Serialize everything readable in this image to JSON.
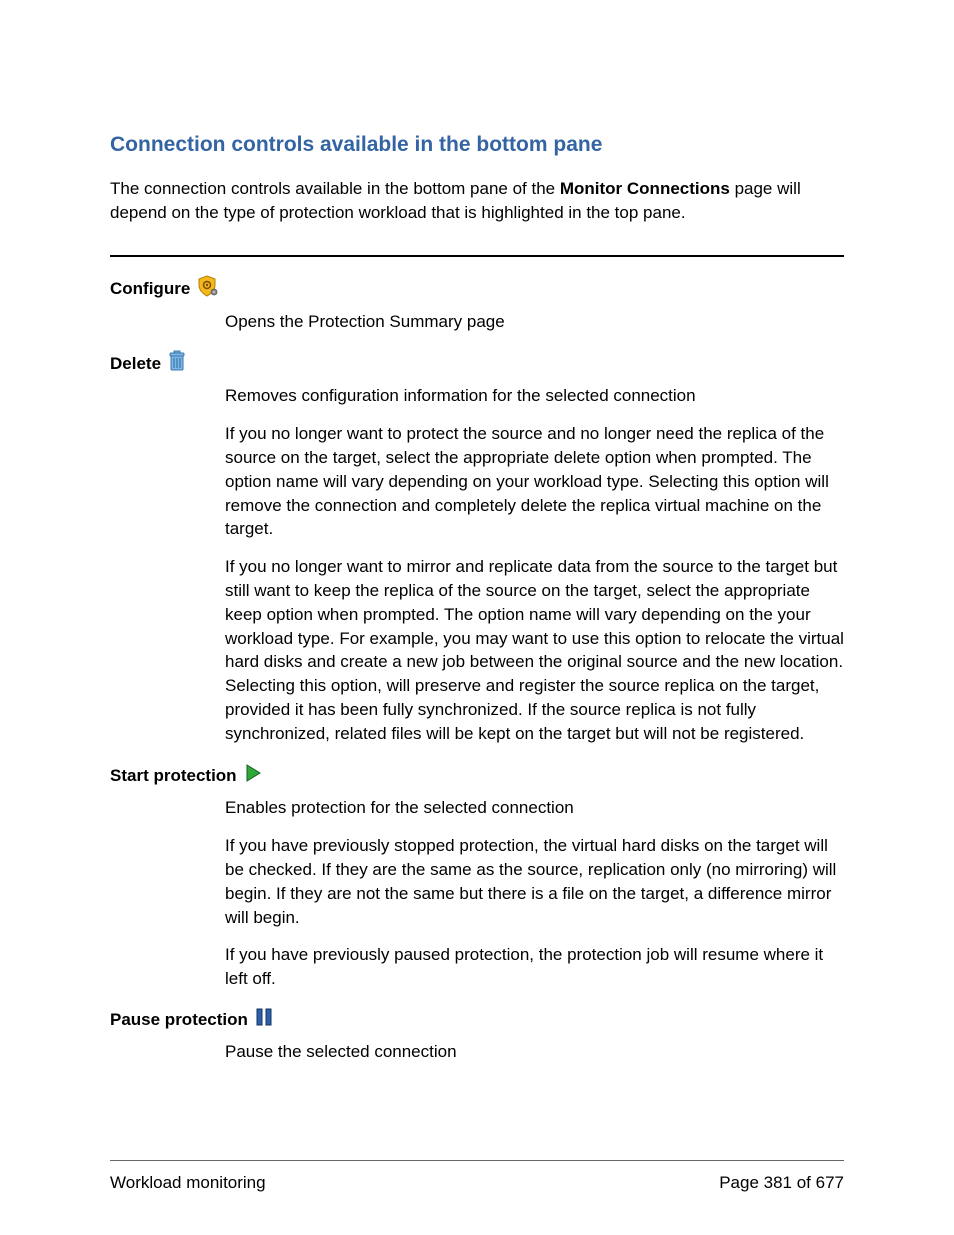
{
  "title": "Connection controls available in the bottom pane",
  "intro_pre": "The connection controls available in the bottom pane of the ",
  "intro_bold": "Monitor Connections",
  "intro_post": " page will depend on the type of protection workload that is highlighted in the top pane.",
  "items": {
    "configure": {
      "label": "Configure",
      "p1": "Opens the Protection Summary page"
    },
    "delete": {
      "label": "Delete",
      "p1": "Removes configuration information for the selected connection",
      "p2": "If you no longer want to protect the source and no longer need the replica of the source on the target, select the appropriate delete option when prompted. The option name will vary depending on your workload type. Selecting this option will remove the connection and completely delete the replica virtual machine on the target.",
      "p3": "If you no longer want to mirror and replicate data from the source to the target but still want to keep the replica of the source on the target, select the appropriate keep option when prompted. The option name will vary depending on the your workload type. For example, you may want to use this option to relocate the virtual hard disks and create a new job between the original source and the new location. Selecting this option, will preserve and register the source replica on the target, provided it has been fully synchronized. If the source replica is not fully synchronized, related files will be kept on the target but will not be registered."
    },
    "start": {
      "label": "Start protection",
      "p1": "Enables protection for the selected connection",
      "p2": "If you have previously stopped protection, the virtual hard disks on the target will be checked. If they are the same as the source, replication only (no mirroring) will begin. If they are not the same but there is a file on the target, a difference mirror will begin.",
      "p3": "If you have previously paused protection, the protection job will resume where it left off."
    },
    "pause": {
      "label": "Pause protection",
      "p1": "Pause the selected connection"
    }
  },
  "footer": {
    "left": "Workload monitoring",
    "right": "Page 381 of 677"
  }
}
